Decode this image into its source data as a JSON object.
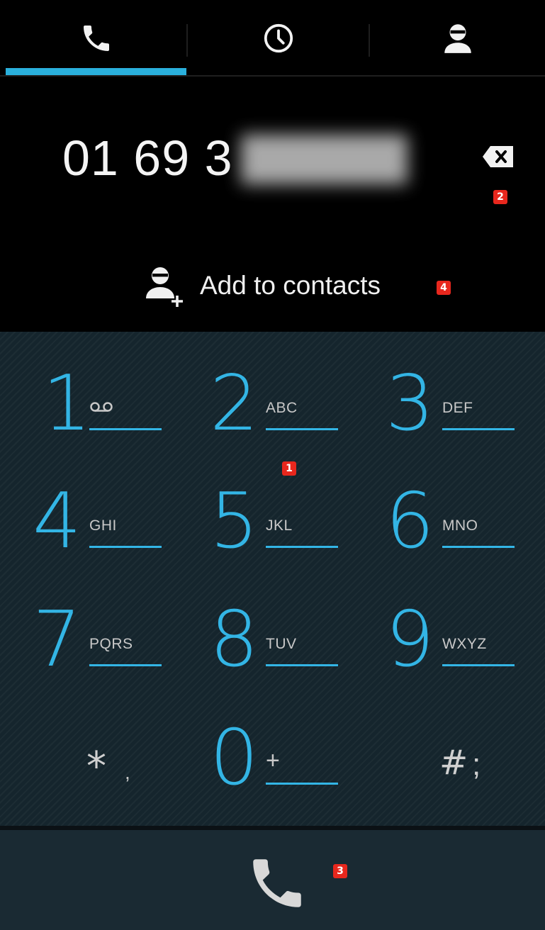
{
  "tabs": [
    {
      "name": "phone",
      "icon": "phone-icon",
      "active": true
    },
    {
      "name": "recent",
      "icon": "clock-icon",
      "active": false
    },
    {
      "name": "contacts",
      "icon": "person-icon",
      "active": false
    }
  ],
  "display": {
    "number_visible": "01 69 3",
    "badge_backspace": "2"
  },
  "add_contacts": {
    "label": "Add to contacts",
    "badge": "4"
  },
  "keypad": {
    "badge": "1",
    "keys": [
      {
        "digit": "1",
        "letters": "",
        "icon": "voicemail-icon"
      },
      {
        "digit": "2",
        "letters": "ABC"
      },
      {
        "digit": "3",
        "letters": "DEF"
      },
      {
        "digit": "4",
        "letters": "GHI"
      },
      {
        "digit": "5",
        "letters": "JKL"
      },
      {
        "digit": "6",
        "letters": "MNO"
      },
      {
        "digit": "7",
        "letters": "PQRS"
      },
      {
        "digit": "8",
        "letters": "TUV"
      },
      {
        "digit": "9",
        "letters": "WXYZ"
      },
      {
        "digit": "*",
        "letters": ","
      },
      {
        "digit": "0",
        "letters": "+"
      },
      {
        "digit": "#",
        "letters": ";"
      }
    ]
  },
  "call": {
    "badge": "3"
  },
  "colors": {
    "accent": "#33b5e5",
    "badge": "#e8271d",
    "keypad_bg": "#15252d"
  }
}
